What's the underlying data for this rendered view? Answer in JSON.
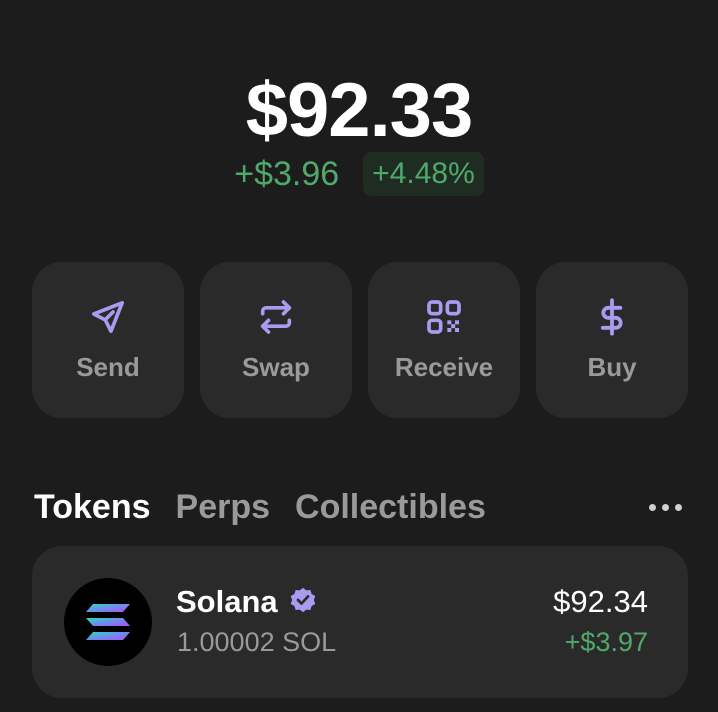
{
  "balance": {
    "total": "$92.33",
    "change_amount": "+$3.96",
    "change_percent": "+4.48%"
  },
  "actions": [
    {
      "label": "Send",
      "icon": "send-icon"
    },
    {
      "label": "Swap",
      "icon": "swap-icon"
    },
    {
      "label": "Receive",
      "icon": "qr-code-icon"
    },
    {
      "label": "Buy",
      "icon": "dollar-icon"
    }
  ],
  "tabs": [
    {
      "label": "Tokens",
      "active": true
    },
    {
      "label": "Perps",
      "active": false
    },
    {
      "label": "Collectibles",
      "active": false
    }
  ],
  "tokens": [
    {
      "name": "Solana",
      "verified": true,
      "amount": "1.00002 SOL",
      "value": "$92.34",
      "change": "+$3.97"
    }
  ],
  "colors": {
    "accent": "#a99bf0",
    "positive": "#4fa96a",
    "background": "#1c1c1c",
    "card": "#2a2a2a"
  }
}
